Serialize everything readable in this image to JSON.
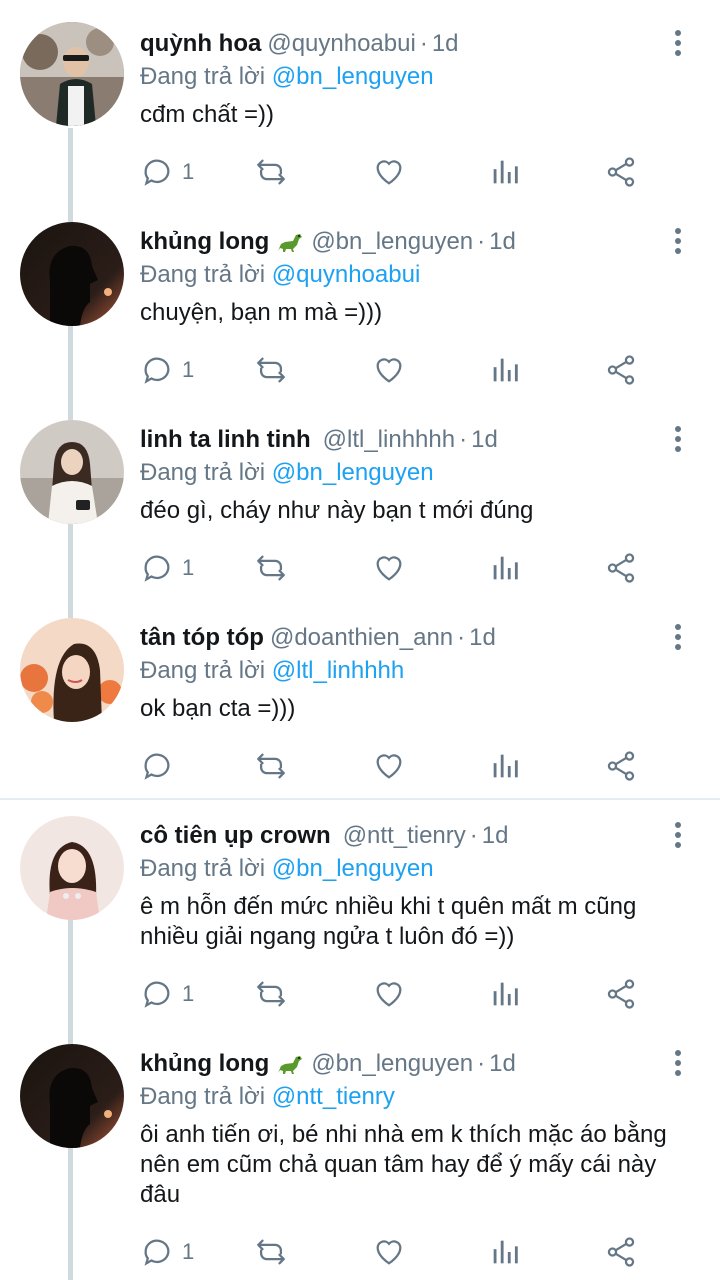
{
  "colors": {
    "link": "#1da1f2",
    "muted": "#657786",
    "text": "#14171a",
    "thread_line": "#cfd9de"
  },
  "icons": {
    "reply": "reply-icon",
    "retweet": "retweet-icon",
    "like": "heart-icon",
    "stats": "analytics-icon",
    "share": "share-icon",
    "more": "more-options-icon"
  },
  "tweets": [
    {
      "name": "quỳnh hoa",
      "handle": "@quynhoabui",
      "time": "1d",
      "reply_prefix": "Đang trả lời",
      "reply_to": "@bn_lenguyen",
      "text": "cđm chất =))",
      "reply_count": "1"
    },
    {
      "name": "khủng long",
      "handle": "@bn_lenguyen",
      "time": "1d",
      "reply_prefix": "Đang trả lời",
      "reply_to": "@quynhoabui",
      "text": "chuyện, bạn m mà =)))",
      "reply_count": "1"
    },
    {
      "name": "linh ta linh tinh",
      "handle": "@ltl_linhhhh",
      "time": "1d",
      "reply_prefix": "Đang trả lời",
      "reply_to": "@bn_lenguyen",
      "text": "đéo gì, cháy như này bạn t mới đúng",
      "reply_count": "1"
    },
    {
      "name": "tân tóp tóp",
      "handle": "@doanthien_ann",
      "time": "1d",
      "reply_prefix": "Đang trả lời",
      "reply_to": "@ltl_linhhhh",
      "text": "ok bạn cta =)))",
      "reply_count": ""
    },
    {
      "name": "cô tiên ụp crown",
      "handle": "@ntt_tienry",
      "time": "1d",
      "reply_prefix": "Đang trả lời",
      "reply_to": "@bn_lenguyen",
      "text": "ê m hỗn đến mức nhiều khi t quên mất m cũng nhiều giải ngang ngửa t luôn đó =))",
      "reply_count": "1"
    },
    {
      "name": "khủng long",
      "handle": "@bn_lenguyen",
      "time": "1d",
      "reply_prefix": "Đang trả lời",
      "reply_to": "@ntt_tienry",
      "text": "ôi anh tiến ơi, bé nhi nhà em k thích mặc áo bằng nên em cũm chả quan tâm hay để ý mấy cái này đâu",
      "reply_count": "1"
    }
  ],
  "separator": "·"
}
